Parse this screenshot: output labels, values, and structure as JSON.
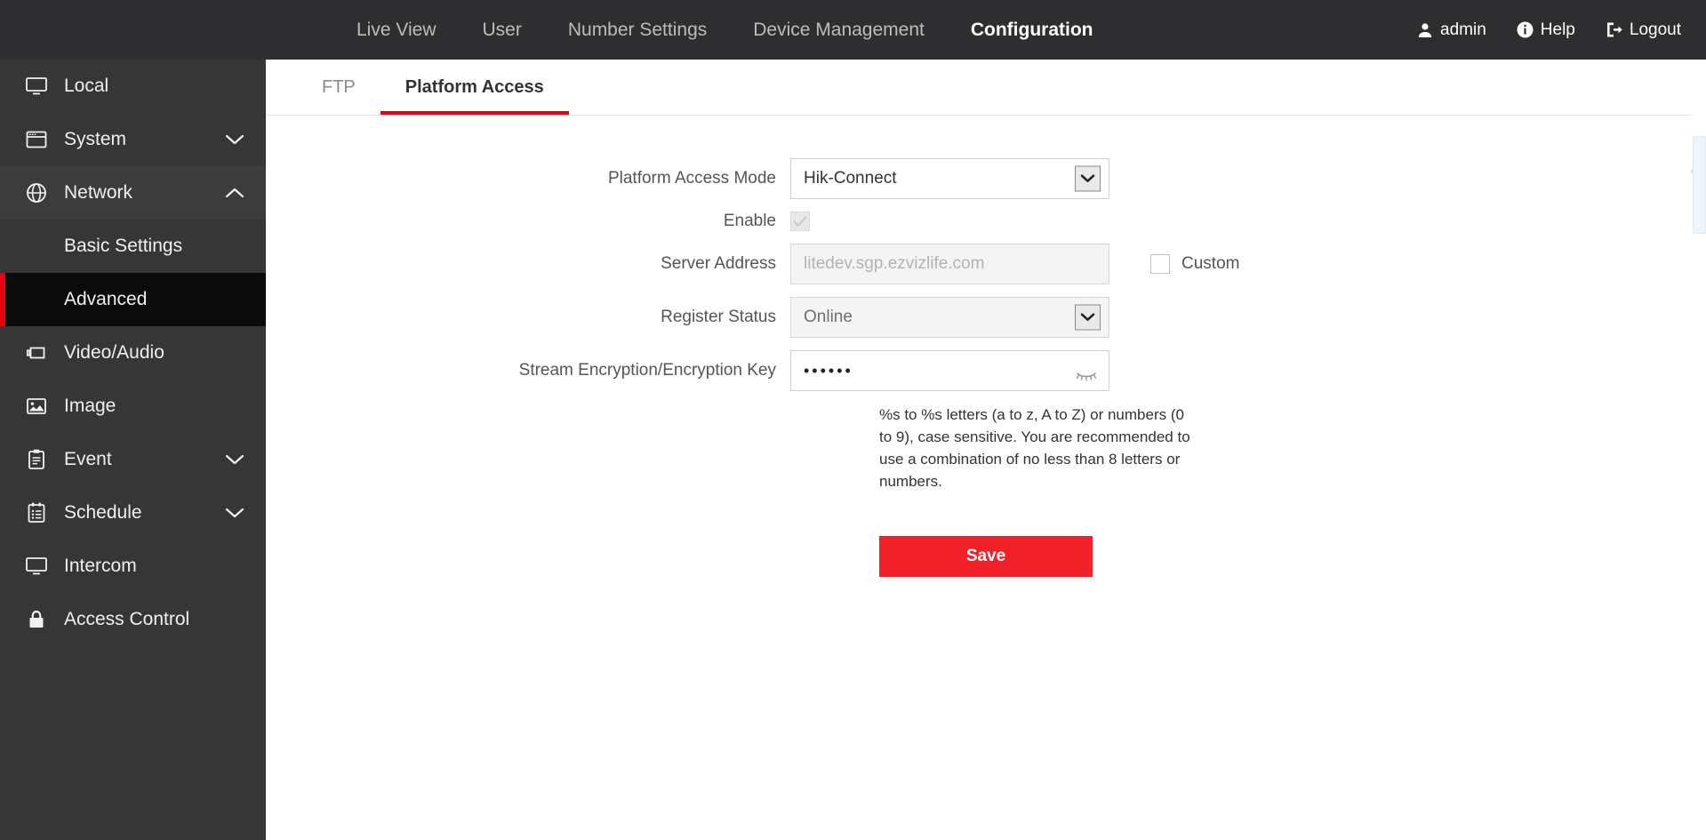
{
  "header": {
    "nav": [
      {
        "label": "Live View",
        "active": false
      },
      {
        "label": "User",
        "active": false
      },
      {
        "label": "Number Settings",
        "active": false
      },
      {
        "label": "Device Management",
        "active": false
      },
      {
        "label": "Configuration",
        "active": true
      }
    ],
    "account": "admin",
    "help": "Help",
    "logout": "Logout"
  },
  "sidebar": {
    "items": [
      {
        "label": "Local",
        "icon": "monitor-icon",
        "chevron": "none"
      },
      {
        "label": "System",
        "icon": "window-icon",
        "chevron": "down"
      },
      {
        "label": "Network",
        "icon": "globe-icon",
        "chevron": "up"
      },
      {
        "label": "Video/Audio",
        "icon": "camera-icon",
        "chevron": "none"
      },
      {
        "label": "Image",
        "icon": "picture-icon",
        "chevron": "none"
      },
      {
        "label": "Event",
        "icon": "clipboard-icon",
        "chevron": "down"
      },
      {
        "label": "Schedule",
        "icon": "checklist-icon",
        "chevron": "down"
      },
      {
        "label": "Intercom",
        "icon": "monitor-icon",
        "chevron": "none"
      },
      {
        "label": "Access Control",
        "icon": "lock-icon",
        "chevron": "none"
      }
    ],
    "network_children": [
      {
        "label": "Basic Settings",
        "active": false
      },
      {
        "label": "Advanced",
        "active": true
      }
    ]
  },
  "tabs": [
    {
      "label": "FTP",
      "active": false
    },
    {
      "label": "Platform Access",
      "active": true
    }
  ],
  "form": {
    "platform_access_mode": {
      "label": "Platform Access Mode",
      "value": "Hik-Connect"
    },
    "enable": {
      "label": "Enable",
      "checked": true
    },
    "server_address": {
      "label": "Server Address",
      "value": "",
      "placeholder": "litedev.sgp.ezvizlife.com"
    },
    "custom": {
      "label": "Custom",
      "checked": false
    },
    "register_status": {
      "label": "Register Status",
      "value": "Online"
    },
    "encryption_key": {
      "label": "Stream Encryption/Encryption Key",
      "value": "••••••"
    },
    "hint": "%s to %s letters (a to z, A to Z) or numbers (0 to 9), case sensitive. You are recommended to use a combination of no less than 8 letters or numbers.",
    "save_label": "Save"
  },
  "colors": {
    "accent_red": "#e60012",
    "save_red": "#f22028",
    "topbar": "#2e2e30",
    "sidebar": "#363636",
    "sidebar_active": "#0b0b0b"
  }
}
